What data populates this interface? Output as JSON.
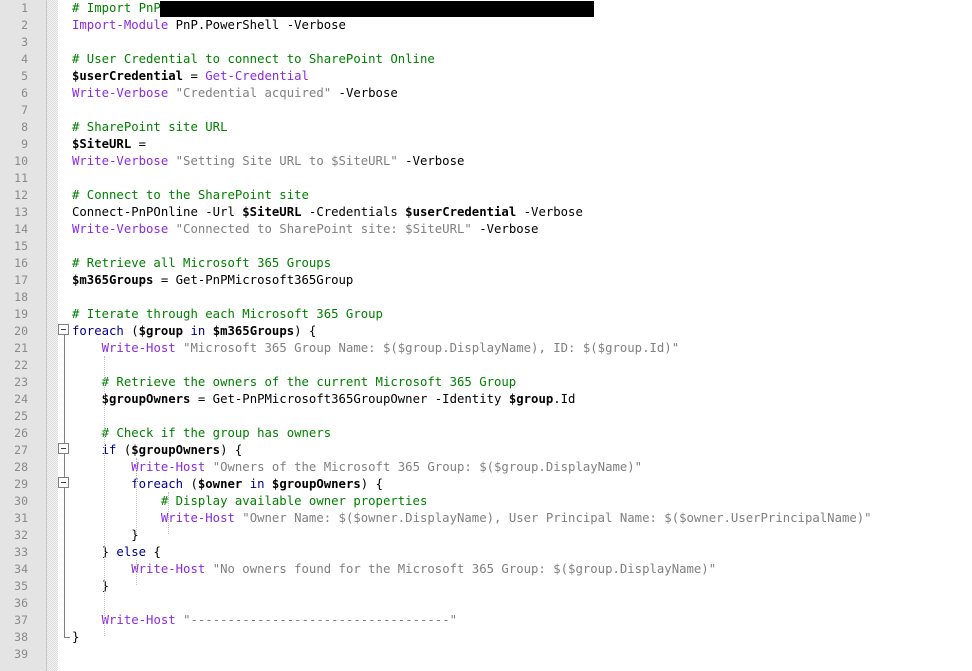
{
  "editor": {
    "lines": [
      {
        "n": "1",
        "tokens": [
          {
            "c": "cmt",
            "t": "# Import PnP PowerShell module"
          }
        ]
      },
      {
        "n": "2",
        "tokens": [
          {
            "c": "cmd",
            "t": "Import-Module"
          },
          {
            "c": "op",
            "t": " PnP.PowerShell -Verbose"
          }
        ]
      },
      {
        "n": "3",
        "tokens": []
      },
      {
        "n": "4",
        "tokens": [
          {
            "c": "cmt",
            "t": "# User Credential to connect to SharePoint Online"
          }
        ]
      },
      {
        "n": "5",
        "tokens": [
          {
            "c": "var",
            "t": "$userCredential"
          },
          {
            "c": "op",
            "t": " = "
          },
          {
            "c": "cmd",
            "t": "Get-Credential"
          }
        ]
      },
      {
        "n": "6",
        "tokens": [
          {
            "c": "cmd",
            "t": "Write-Verbose"
          },
          {
            "c": "op",
            "t": " "
          },
          {
            "c": "str",
            "t": "\"Credential acquired\""
          },
          {
            "c": "op",
            "t": " -Verbose"
          }
        ]
      },
      {
        "n": "7",
        "tokens": []
      },
      {
        "n": "8",
        "tokens": [
          {
            "c": "cmt",
            "t": "# SharePoint site URL"
          }
        ]
      },
      {
        "n": "9",
        "tokens": [
          {
            "c": "var",
            "t": "$SiteURL"
          },
          {
            "c": "op",
            "t": " = "
          }
        ]
      },
      {
        "n": "10",
        "tokens": [
          {
            "c": "cmd",
            "t": "Write-Verbose"
          },
          {
            "c": "op",
            "t": " "
          },
          {
            "c": "str",
            "t": "\"Setting Site URL to $SiteURL\""
          },
          {
            "c": "op",
            "t": " -Verbose"
          }
        ]
      },
      {
        "n": "11",
        "tokens": []
      },
      {
        "n": "12",
        "tokens": [
          {
            "c": "cmt",
            "t": "# Connect to the SharePoint site"
          }
        ]
      },
      {
        "n": "13",
        "tokens": [
          {
            "c": "op",
            "t": "Connect-PnPOnline -Url "
          },
          {
            "c": "var",
            "t": "$SiteURL"
          },
          {
            "c": "op",
            "t": " -Credentials "
          },
          {
            "c": "var",
            "t": "$userCredential"
          },
          {
            "c": "op",
            "t": " -Verbose"
          }
        ]
      },
      {
        "n": "14",
        "tokens": [
          {
            "c": "cmd",
            "t": "Write-Verbose"
          },
          {
            "c": "op",
            "t": " "
          },
          {
            "c": "str",
            "t": "\"Connected to SharePoint site: $SiteURL\""
          },
          {
            "c": "op",
            "t": " -Verbose"
          }
        ]
      },
      {
        "n": "15",
        "tokens": []
      },
      {
        "n": "16",
        "tokens": [
          {
            "c": "cmt",
            "t": "# Retrieve all Microsoft 365 Groups"
          }
        ]
      },
      {
        "n": "17",
        "tokens": [
          {
            "c": "var",
            "t": "$m365Groups"
          },
          {
            "c": "op",
            "t": " = Get-PnPMicrosoft365Group"
          }
        ]
      },
      {
        "n": "18",
        "tokens": []
      },
      {
        "n": "19",
        "tokens": [
          {
            "c": "cmt",
            "t": "# Iterate through each Microsoft 365 Group"
          }
        ]
      },
      {
        "n": "20",
        "tokens": [
          {
            "c": "kw",
            "t": "foreach"
          },
          {
            "c": "op",
            "t": " ("
          },
          {
            "c": "var",
            "t": "$group"
          },
          {
            "c": "op",
            "t": " "
          },
          {
            "c": "kw",
            "t": "in"
          },
          {
            "c": "op",
            "t": " "
          },
          {
            "c": "var",
            "t": "$m365Groups"
          },
          {
            "c": "op",
            "t": ") {"
          }
        ]
      },
      {
        "n": "21",
        "tokens": [
          {
            "c": "op",
            "t": "    "
          },
          {
            "c": "cmd",
            "t": "Write-Host"
          },
          {
            "c": "op",
            "t": " "
          },
          {
            "c": "str",
            "t": "\"Microsoft 365 Group Name: $($group.DisplayName), ID: $($group.Id)\""
          }
        ]
      },
      {
        "n": "22",
        "tokens": []
      },
      {
        "n": "23",
        "tokens": [
          {
            "c": "op",
            "t": "    "
          },
          {
            "c": "cmt",
            "t": "# Retrieve the owners of the current Microsoft 365 Group"
          }
        ]
      },
      {
        "n": "24",
        "tokens": [
          {
            "c": "op",
            "t": "    "
          },
          {
            "c": "var",
            "t": "$groupOwners"
          },
          {
            "c": "op",
            "t": " = Get-PnPMicrosoft365GroupOwner -Identity "
          },
          {
            "c": "var",
            "t": "$group"
          },
          {
            "c": "op",
            "t": ".Id"
          }
        ]
      },
      {
        "n": "25",
        "tokens": []
      },
      {
        "n": "26",
        "tokens": [
          {
            "c": "op",
            "t": "    "
          },
          {
            "c": "cmt",
            "t": "# Check if the group has owners"
          }
        ]
      },
      {
        "n": "27",
        "tokens": [
          {
            "c": "op",
            "t": "    "
          },
          {
            "c": "kw",
            "t": "if"
          },
          {
            "c": "op",
            "t": " ("
          },
          {
            "c": "var",
            "t": "$groupOwners"
          },
          {
            "c": "op",
            "t": ") {"
          }
        ]
      },
      {
        "n": "28",
        "tokens": [
          {
            "c": "op",
            "t": "        "
          },
          {
            "c": "cmd",
            "t": "Write-Host"
          },
          {
            "c": "op",
            "t": " "
          },
          {
            "c": "str",
            "t": "\"Owners of the Microsoft 365 Group: $($group.DisplayName)\""
          }
        ]
      },
      {
        "n": "29",
        "tokens": [
          {
            "c": "op",
            "t": "        "
          },
          {
            "c": "kw",
            "t": "foreach"
          },
          {
            "c": "op",
            "t": " ("
          },
          {
            "c": "var",
            "t": "$owner"
          },
          {
            "c": "op",
            "t": " "
          },
          {
            "c": "kw",
            "t": "in"
          },
          {
            "c": "op",
            "t": " "
          },
          {
            "c": "var",
            "t": "$groupOwners"
          },
          {
            "c": "op",
            "t": ") {"
          }
        ]
      },
      {
        "n": "30",
        "tokens": [
          {
            "c": "op",
            "t": "            "
          },
          {
            "c": "cmt",
            "t": "# Display available owner properties"
          }
        ]
      },
      {
        "n": "31",
        "tokens": [
          {
            "c": "op",
            "t": "            "
          },
          {
            "c": "cmd",
            "t": "Write-Host"
          },
          {
            "c": "op",
            "t": " "
          },
          {
            "c": "str",
            "t": "\"Owner Name: $($owner.DisplayName), User Principal Name: $($owner.UserPrincipalName)\""
          }
        ]
      },
      {
        "n": "32",
        "tokens": [
          {
            "c": "op",
            "t": "        }"
          }
        ]
      },
      {
        "n": "33",
        "tokens": [
          {
            "c": "op",
            "t": "    } "
          },
          {
            "c": "kw",
            "t": "else"
          },
          {
            "c": "op",
            "t": " {"
          }
        ]
      },
      {
        "n": "34",
        "tokens": [
          {
            "c": "op",
            "t": "        "
          },
          {
            "c": "cmd",
            "t": "Write-Host"
          },
          {
            "c": "op",
            "t": " "
          },
          {
            "c": "str",
            "t": "\"No owners found for the Microsoft 365 Group: $($group.DisplayName)\""
          }
        ]
      },
      {
        "n": "35",
        "tokens": [
          {
            "c": "op",
            "t": "    }"
          }
        ]
      },
      {
        "n": "36",
        "tokens": []
      },
      {
        "n": "37",
        "tokens": [
          {
            "c": "op",
            "t": "    "
          },
          {
            "c": "cmd",
            "t": "Write-Host"
          },
          {
            "c": "op",
            "t": " "
          },
          {
            "c": "str",
            "t": "\"-----------------------------------\""
          }
        ]
      },
      {
        "n": "38",
        "tokens": [
          {
            "c": "op",
            "t": "}"
          }
        ]
      },
      {
        "n": "39",
        "tokens": []
      }
    ]
  },
  "colors": {
    "comment": "#008000",
    "keyword": "#00008b",
    "cmdlet": "#8a2be2",
    "string": "#808080",
    "gutter": "#e4e4e4"
  }
}
